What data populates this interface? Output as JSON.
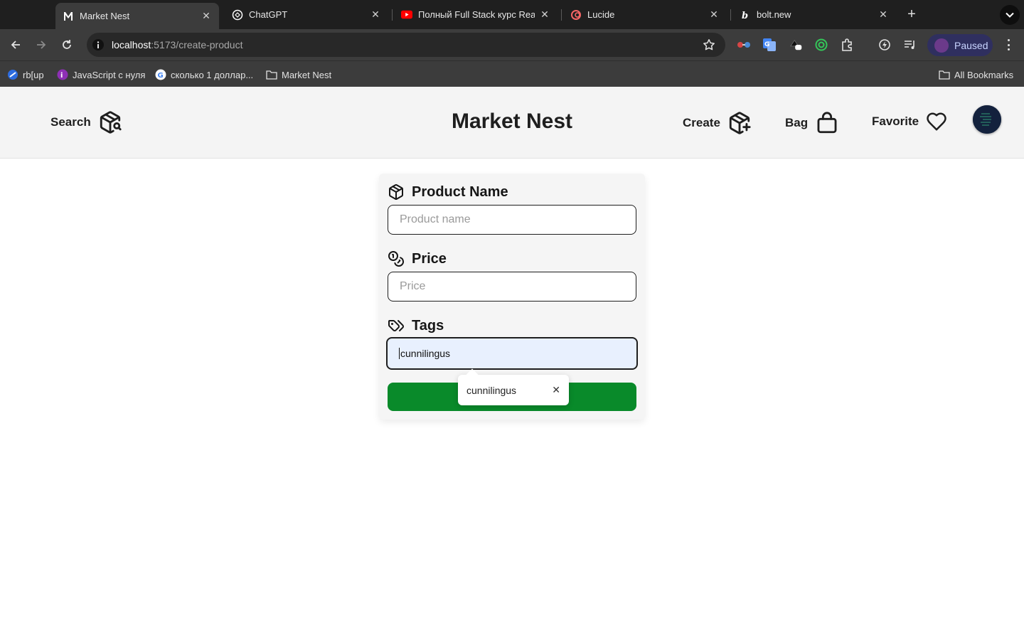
{
  "browser": {
    "tabs": [
      {
        "title": "Market Nest",
        "active": true,
        "favicon": "market-nest-favicon"
      },
      {
        "title": "ChatGPT",
        "active": false,
        "favicon": "chatgpt-favicon"
      },
      {
        "title": "Полный Full Stack курс Reac",
        "active": false,
        "favicon": "youtube-favicon"
      },
      {
        "title": "Lucide",
        "active": false,
        "favicon": "lucide-favicon"
      },
      {
        "title": "bolt.new",
        "active": false,
        "favicon": "bolt-favicon"
      }
    ],
    "close_glyph": "✕",
    "new_tab_glyph": "+",
    "url_host": "localhost",
    "url_path": ":5173/create-product",
    "profile_label": "Paused",
    "bookmarks": [
      {
        "label": "rb[up",
        "icon": "rb-icon"
      },
      {
        "label": "JavaScript с нуля",
        "icon": "js-icon"
      },
      {
        "label": "сколько 1 доллар...",
        "icon": "google-icon"
      },
      {
        "label": "Market Nest",
        "icon": "folder-icon"
      }
    ],
    "all_bookmarks_label": "All Bookmarks"
  },
  "header": {
    "search_label": "Search",
    "brand": "Market Nest",
    "create_label": "Create",
    "bag_label": "Bag",
    "favorite_label": "Favorite"
  },
  "form": {
    "product_name_label": "Product Name",
    "product_name_placeholder": "Product name",
    "price_label": "Price",
    "price_placeholder": "Price",
    "tags_label": "Tags",
    "tags_value": "cunnilingus"
  },
  "autofill": {
    "suggestion": "cunnilingus",
    "remove_glyph": "✕"
  },
  "colors": {
    "submit_button": "#098a2a",
    "header_bg": "#f4f4f4",
    "focused_input_bg": "#e8f0fe"
  }
}
